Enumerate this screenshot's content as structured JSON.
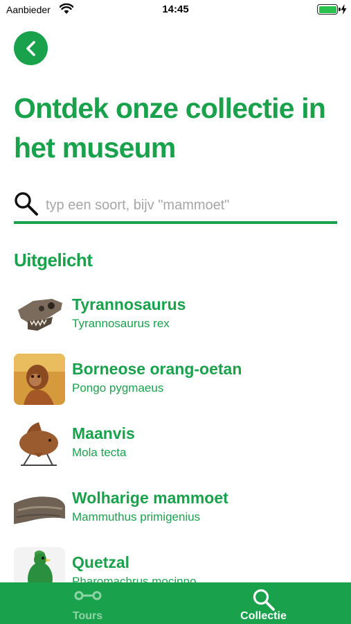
{
  "status_bar": {
    "carrier": "Aanbieder",
    "time": "14:45",
    "battery_level": 1.0
  },
  "header": {
    "back_icon": "chevron-left-icon",
    "title": "Ontdek onze collectie in het museum"
  },
  "search": {
    "icon": "search-icon",
    "placeholder": "typ een soort, bijv \"mammoet\"",
    "value": ""
  },
  "featured": {
    "heading": "Uitgelicht",
    "items": [
      {
        "name": "Tyrannosaurus",
        "latin": "Tyrannosaurus rex",
        "thumb": "t-rex-skull-image"
      },
      {
        "name": "Borneose orang-oetan",
        "latin": "Pongo pygmaeus",
        "thumb": "orangutan-image"
      },
      {
        "name": "Maanvis",
        "latin": "Mola tecta",
        "thumb": "sunfish-image"
      },
      {
        "name": "Wolharige mammoet",
        "latin": "Mammuthus primigenius",
        "thumb": "mammoth-tusk-image"
      },
      {
        "name": "Quetzal",
        "latin": "Pharomachrus mocinno",
        "thumb": "quetzal-image"
      }
    ]
  },
  "tab_bar": {
    "tabs": [
      {
        "label": "Tours",
        "icon": "route-icon",
        "active": false
      },
      {
        "label": "Collectie",
        "icon": "search-icon",
        "active": true
      }
    ]
  },
  "colors": {
    "accent": "#1aa14c",
    "placeholder": "#a6a6a6",
    "inactive_tab": "#8fd4a6",
    "background": "#ffffff"
  }
}
